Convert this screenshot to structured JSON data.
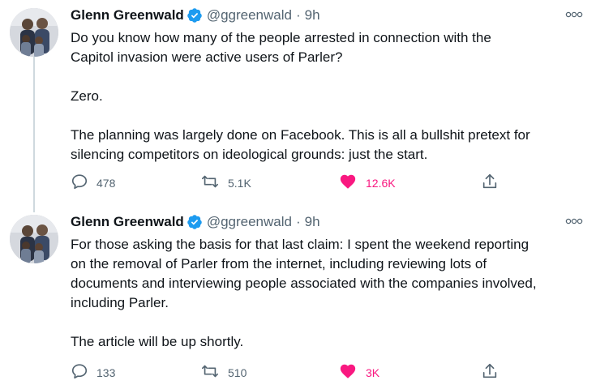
{
  "tweets": [
    {
      "author": {
        "name": "Glenn Greenwald",
        "handle": "@ggreenwald",
        "time": "9h"
      },
      "text": [
        "Do you know how many of the people arrested in connection with the",
        "Capitol invasion were active users of Parler?",
        "",
        "Zero.",
        "",
        "The planning was largely done on Facebook. This is all a bullshit pretext for",
        "silencing competitors on ideological grounds: just the start."
      ],
      "stats": {
        "replies": "478",
        "retweets": "5.1K",
        "likes": "12.6K",
        "liked": true
      }
    },
    {
      "author": {
        "name": "Glenn Greenwald",
        "handle": "@ggreenwald",
        "time": "9h"
      },
      "text": [
        "For those asking the basis for that last claim: I spent the weekend reporting",
        "on the removal of Parler from the internet, including reviewing lots of",
        "documents and interviewing people associated with the companies involved,",
        "including Parler.",
        "",
        "The article will be up shortly."
      ],
      "stats": {
        "replies": "133",
        "retweets": "510",
        "likes": "3K",
        "liked": true
      }
    }
  ],
  "separator": "·",
  "icons": {
    "verified": "verified-badge-icon",
    "more": "more-options-icon",
    "reply": "reply-icon",
    "retweet": "retweet-icon",
    "like": "heart-icon",
    "share": "share-icon"
  },
  "colors": {
    "verified": "#1d9bf0",
    "like": "#f91880",
    "muted": "#536471",
    "text": "#0f1419",
    "thread_line": "#cfd9de"
  }
}
